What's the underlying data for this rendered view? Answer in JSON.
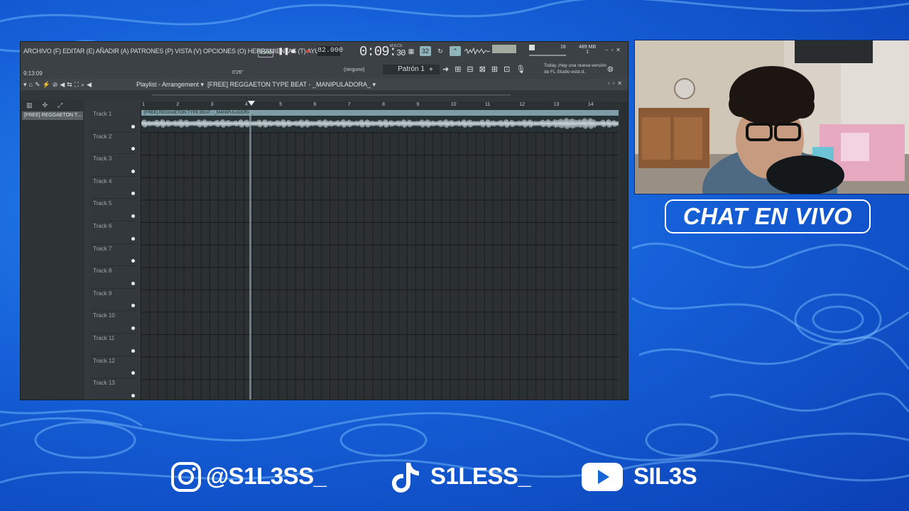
{
  "fl": {
    "menu": "ARCHIVO (F) EDITAR (E) AÑADIR (A) PATRONES (P) VISTA (V) OPCIONES (O) HERRAMIENTAS (T) AYUDA",
    "song_mode": "SONG",
    "tempo": "82.000",
    "time_main": "0:09:",
    "time_sub": "30",
    "time_format": "M:S:CS",
    "time_small": "9:13:09",
    "position_label": "0'26\"",
    "cpu": "16",
    "memory": "489 MB",
    "memory_sub": "1",
    "pattern_selector": "(ninguno)",
    "pattern_name": "Patrón 1",
    "news_label": "Today",
    "news_text": "¡Hay una nueva versión de FL Studio está d..",
    "playlist_title": "Playlist - Arrangement",
    "playlist_pattern": "[FREE] REGGAETON TYPE BEAT - _MANIPULADORA_",
    "picker_item": "[FREE] REGGAETON T...",
    "clip_title": "[FREE] REGGAETON TYPE BEAT - _MANIPULADORA_",
    "ruler": [
      "1",
      "2",
      "3",
      "4",
      "5",
      "6",
      "7",
      "8",
      "9",
      "10",
      "11",
      "12",
      "13",
      "14"
    ],
    "tracks": [
      "Track 1",
      "Track 2",
      "Track 3",
      "Track 4",
      "Track 5",
      "Track 6",
      "Track 7",
      "Track 8",
      "Track 9",
      "Track 10",
      "Track 11",
      "Track 12",
      "Track 13"
    ],
    "colors": {
      "clip_header": "#7d9ca6",
      "record": "#e3413c",
      "grid": "#2b3033"
    }
  },
  "overlay": {
    "chat_label": "CHAT EN VIVO",
    "instagram": "@S1L3SS_",
    "tiktok": "S1LESS_",
    "youtube": "SIL3S"
  },
  "icons": [
    "instagram-icon",
    "tiktok-icon",
    "youtube-icon",
    "play-icon",
    "stop-icon",
    "record-icon",
    "magnet-icon",
    "pencil-icon",
    "globe-icon",
    "mic-icon"
  ]
}
